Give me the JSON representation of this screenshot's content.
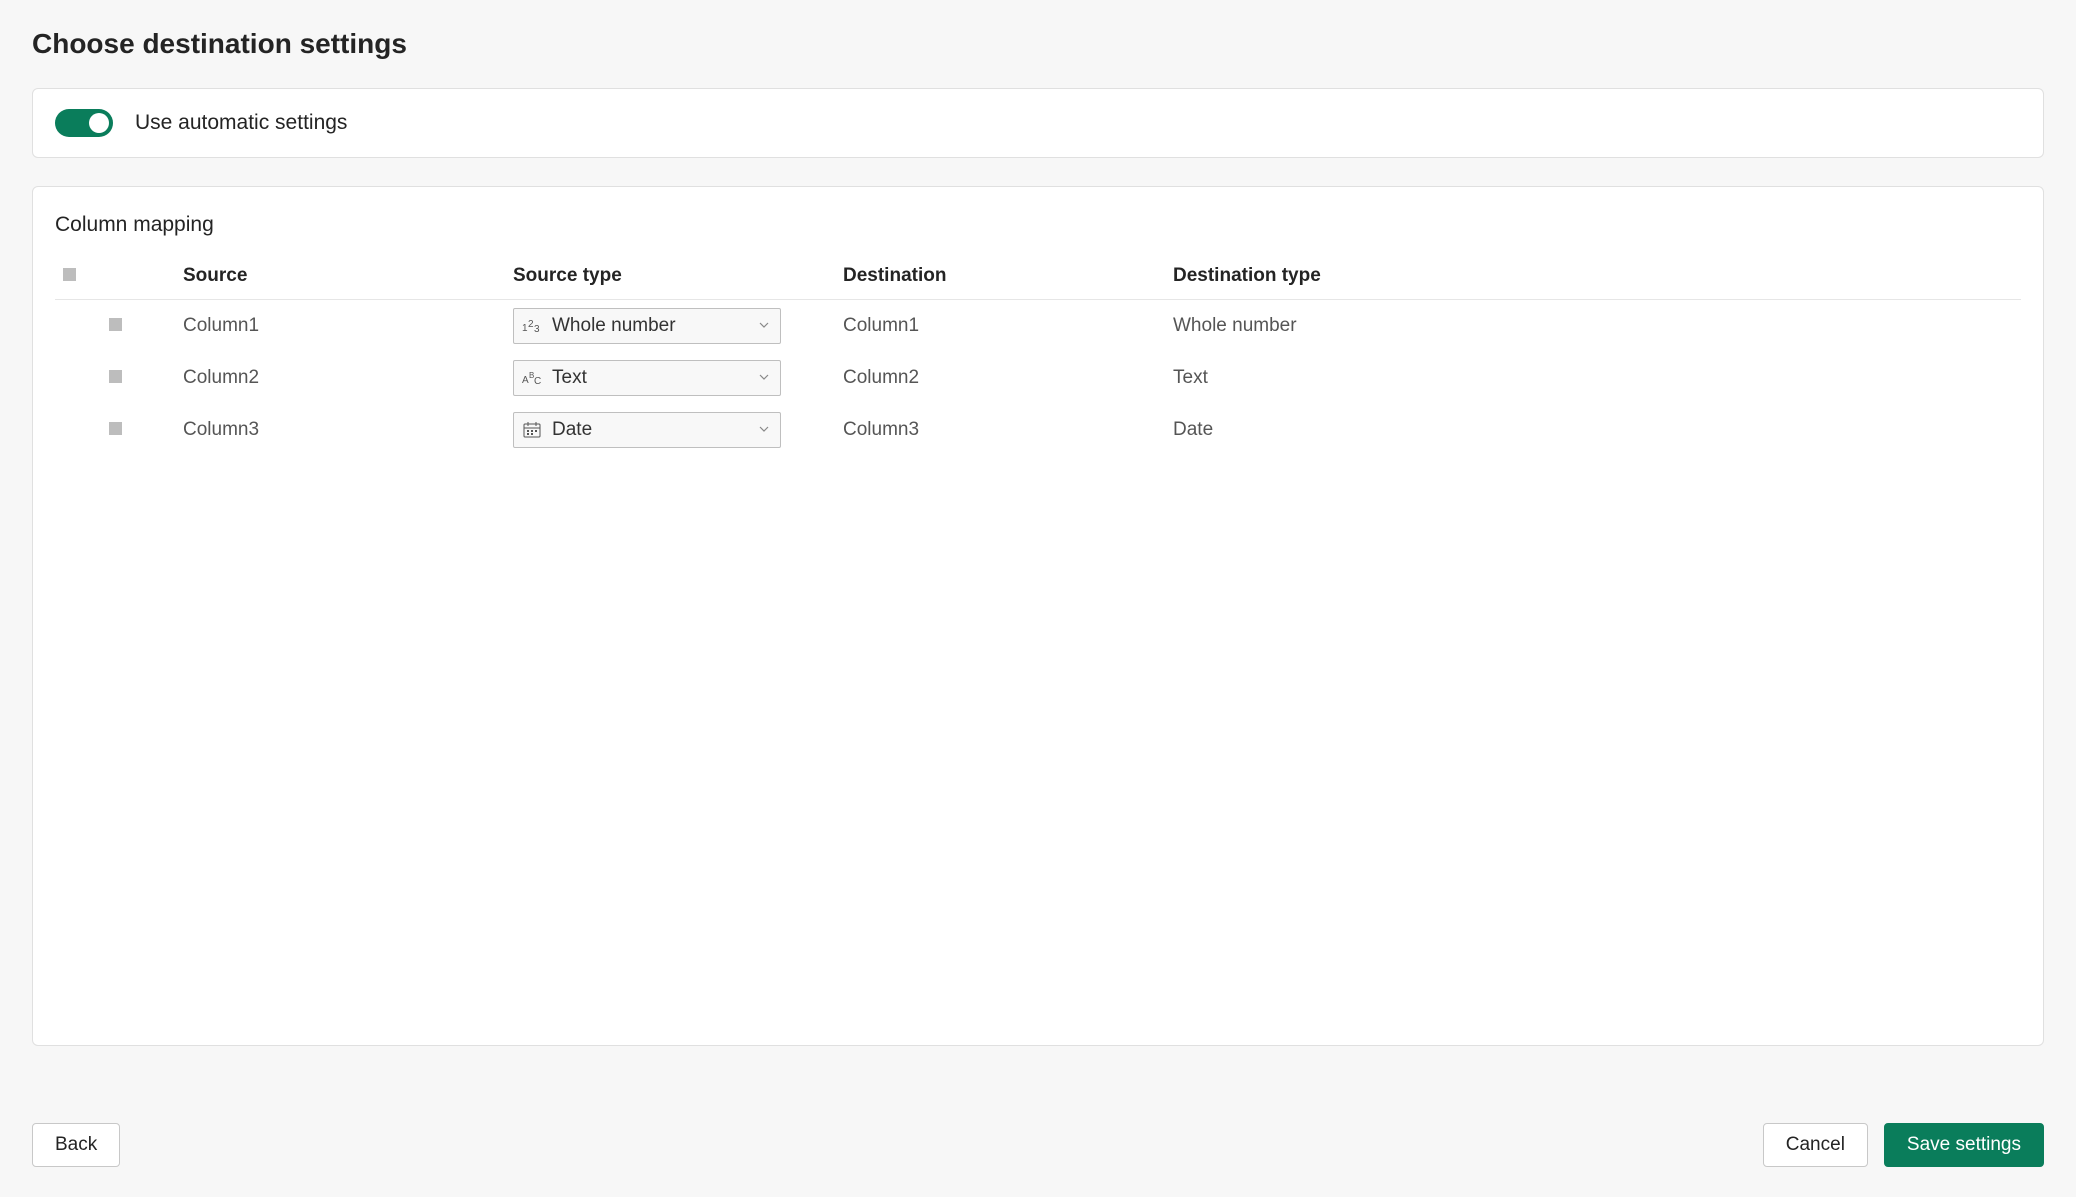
{
  "page_title": "Choose destination settings",
  "auto_toggle": {
    "label": "Use automatic settings",
    "on": true
  },
  "mapping": {
    "title": "Column mapping",
    "headers": {
      "source": "Source",
      "source_type": "Source type",
      "destination": "Destination",
      "destination_type": "Destination type"
    },
    "rows": [
      {
        "source": "Column1",
        "source_type": "Whole number",
        "source_type_icon": "number-icon",
        "destination": "Column1",
        "destination_type": "Whole number"
      },
      {
        "source": "Column2",
        "source_type": "Text",
        "source_type_icon": "text-icon",
        "destination": "Column2",
        "destination_type": "Text"
      },
      {
        "source": "Column3",
        "source_type": "Date",
        "source_type_icon": "date-icon",
        "destination": "Column3",
        "destination_type": "Date"
      }
    ]
  },
  "footer": {
    "back": "Back",
    "cancel": "Cancel",
    "save": "Save settings"
  }
}
